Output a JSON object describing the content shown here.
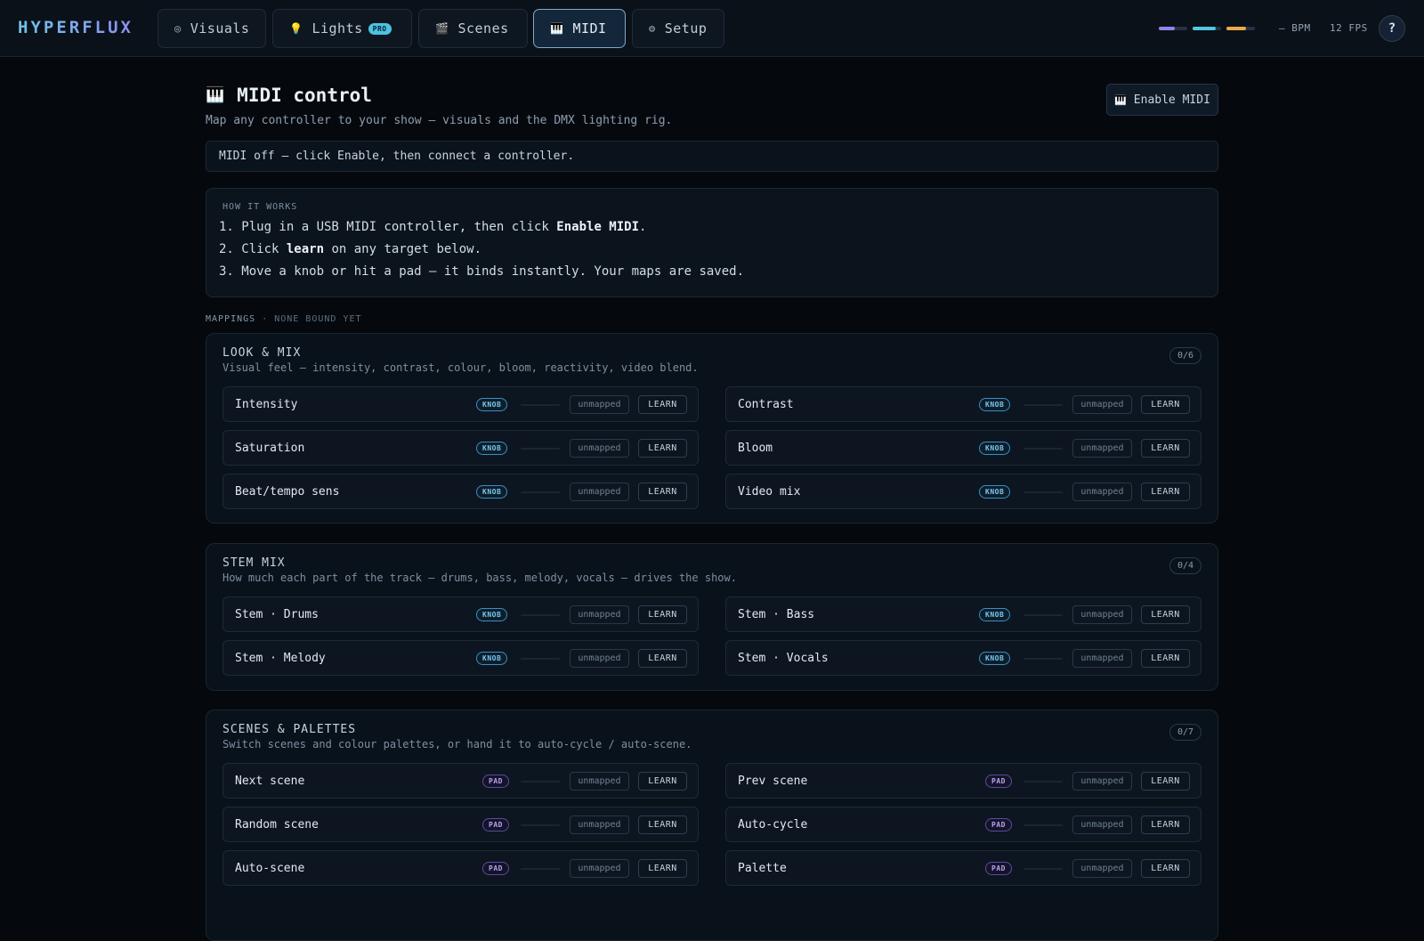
{
  "app": {
    "logo": "HYPERFLUX"
  },
  "nav": {
    "tabs": [
      {
        "label": "Visuals",
        "icon": "◎"
      },
      {
        "label": "Lights",
        "icon": "💡",
        "badge": "PRO"
      },
      {
        "label": "Scenes",
        "icon": "🎬"
      },
      {
        "label": "MIDI",
        "icon": "🎹",
        "active": true
      },
      {
        "label": "Setup",
        "icon": "⚙"
      }
    ]
  },
  "meters": [
    {
      "color": "#8f84e8",
      "level": 0.55
    },
    {
      "color": "#52c6e6",
      "level": 0.8
    },
    {
      "color": "#f0a64a",
      "level": 0.7
    }
  ],
  "status": {
    "bpm": "— BPM",
    "fps": "12 FPS",
    "help_label": "?"
  },
  "header": {
    "icon": "🎹",
    "title": "MIDI control",
    "subtitle": "Map any controller to your show — visuals and the DMX lighting rig.",
    "enable_icon": "🎹",
    "enable_label": "Enable MIDI"
  },
  "midi_status": "MIDI off — click Enable, then connect a controller.",
  "how": {
    "label": "HOW IT WORKS",
    "steps": [
      {
        "prefix": "1. Plug in a USB MIDI controller, then click ",
        "bold": "Enable MIDI",
        "suffix": "."
      },
      {
        "prefix": "2. Click ",
        "bold": "learn",
        "suffix": " on any target below."
      },
      {
        "prefix": "3. Move a knob or hit a pad — it binds instantly. Your maps are saved.",
        "bold": "",
        "suffix": ""
      }
    ]
  },
  "mappings": {
    "label": "MAPPINGS",
    "sublabel": "· NONE BOUND YET",
    "unmapped_label": "unmapped",
    "learn_label": "LEARN",
    "groups": [
      {
        "title": "LOOK & MIX",
        "desc": "Visual feel — intensity, contrast, colour, bloom, reactivity, video blend.",
        "count": "0/6",
        "type": "KNOB",
        "items": [
          "Intensity",
          "Contrast",
          "Saturation",
          "Bloom",
          "Beat/tempo sens",
          "Video mix"
        ]
      },
      {
        "title": "STEM MIX",
        "desc": "How much each part of the track — drums, bass, melody, vocals — drives the show.",
        "count": "0/4",
        "type": "KNOB",
        "items": [
          "Stem · Drums",
          "Stem · Bass",
          "Stem · Melody",
          "Stem · Vocals"
        ]
      },
      {
        "title": "SCENES & PALETTES",
        "desc": "Switch scenes and colour palettes, or hand it to auto-cycle / auto-scene.",
        "count": "0/7",
        "type": "PAD",
        "items": [
          "Next scene",
          "Prev scene",
          "Random scene",
          "Auto-cycle",
          "Auto-scene",
          "Palette"
        ]
      }
    ]
  }
}
